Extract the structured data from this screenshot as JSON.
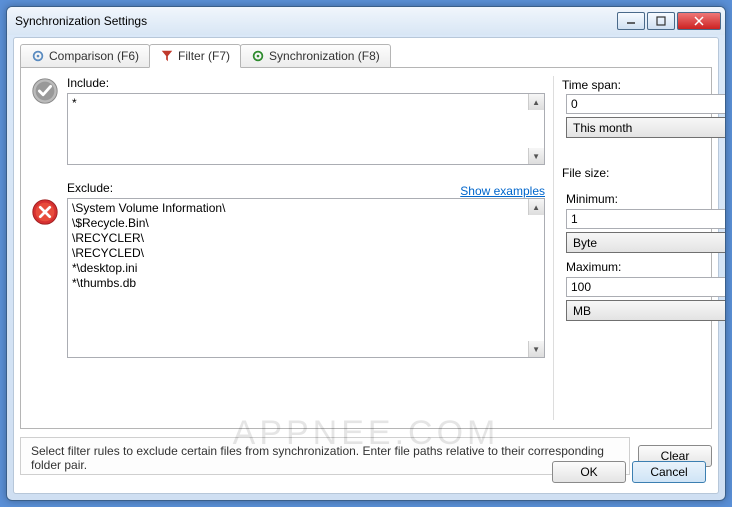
{
  "window": {
    "title": "Synchronization Settings"
  },
  "tabs": {
    "comparison": "Comparison (F6)",
    "filter": "Filter (F7)",
    "synchronization": "Synchronization (F8)"
  },
  "include": {
    "label": "Include:",
    "value": "*"
  },
  "exclude": {
    "label": "Exclude:",
    "show": "Show examples",
    "value": "\\System Volume Information\\\n\\$Recycle.Bin\\\n\\RECYCLER\\\n\\RECYCLED\\\n*\\desktop.ini\n*\\thumbs.db"
  },
  "timespan": {
    "label": "Time span:",
    "value": "0",
    "unit": "This month"
  },
  "filesize": {
    "label": "File size:",
    "min_label": "Minimum:",
    "min_value": "1",
    "min_unit": "Byte",
    "max_label": "Maximum:",
    "max_value": "100",
    "max_unit": "MB"
  },
  "help": "Select filter rules to exclude certain files from synchronization. Enter file paths relative to their corresponding folder pair.",
  "buttons": {
    "clear": "Clear",
    "ok": "OK",
    "cancel": "Cancel"
  },
  "watermark": "APPNEE.COM"
}
